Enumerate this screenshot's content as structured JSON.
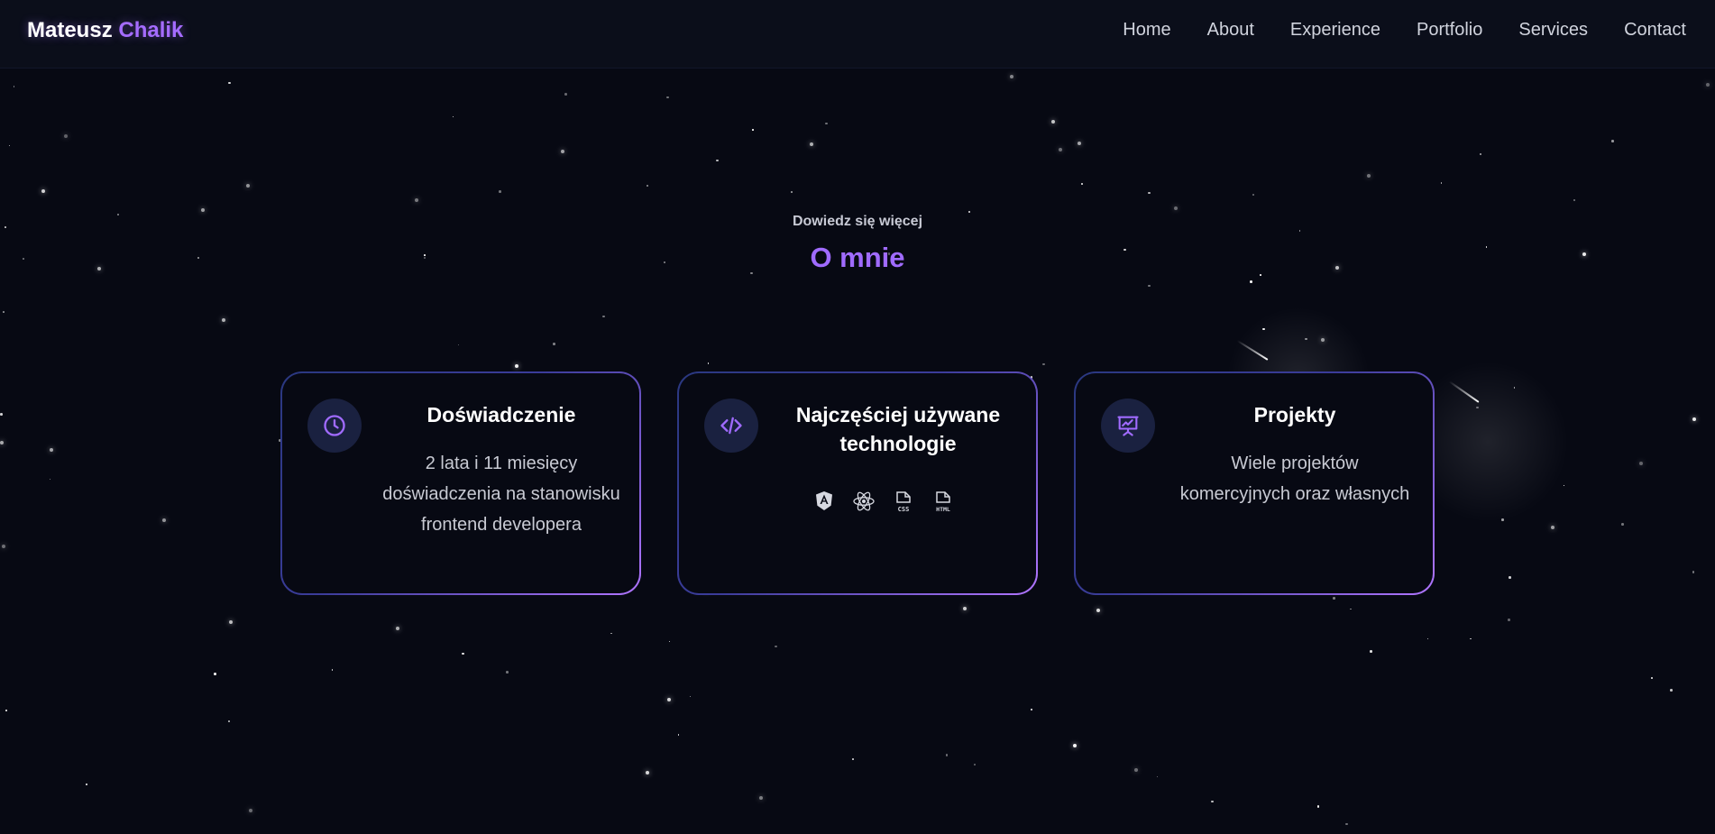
{
  "header": {
    "brand_first": "Mateusz",
    "brand_last": "Chalik",
    "nav": [
      "Home",
      "About",
      "Experience",
      "Portfolio",
      "Services",
      "Contact"
    ]
  },
  "section": {
    "eyebrow": "Dowiedz się więcej",
    "title": "O mnie"
  },
  "cards": [
    {
      "title": "Doświadczenie",
      "icon": "clock-icon",
      "text": "2 lata i 11 miesięcy doświadczenia na stanowisku frontend developera"
    },
    {
      "title": "Najczęściej używane technologie",
      "icon": "code-icon",
      "tech_icons": [
        "angular-icon",
        "react-icon",
        "css-file-icon",
        "html-file-icon"
      ],
      "tech_labels": [
        "CSS",
        "HTML"
      ]
    },
    {
      "title": "Projekty",
      "icon": "presentation-icon",
      "text": "Wiele projektów komercyjnych oraz własnych"
    }
  ],
  "colors": {
    "background": "#070913",
    "accent": "#a56cff",
    "card_icon_bg": "#1a2140"
  }
}
